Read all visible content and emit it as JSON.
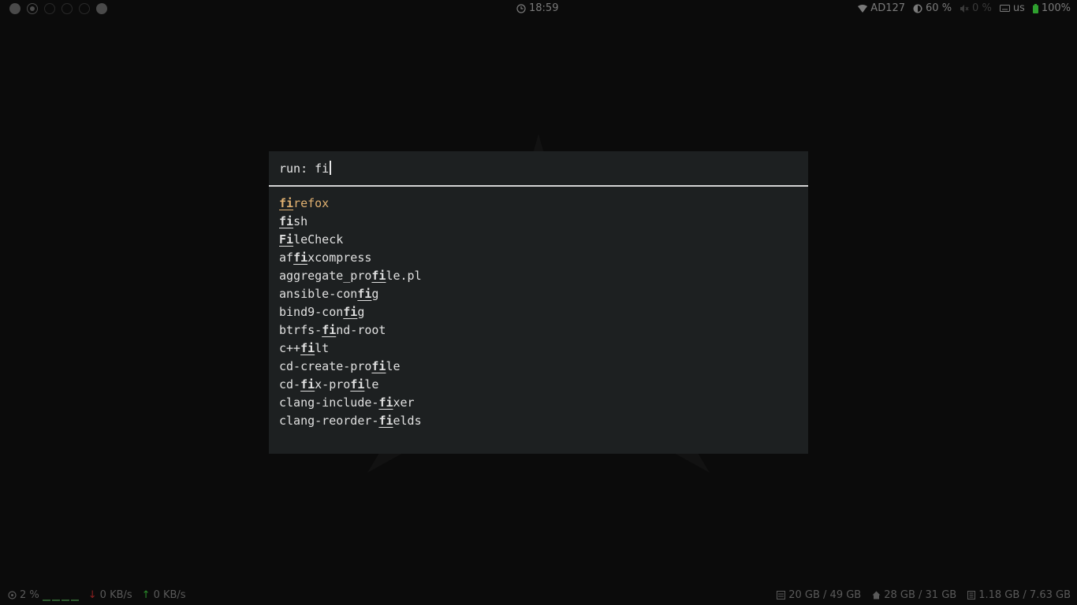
{
  "topbar": {
    "workspaces": [
      "filled",
      "ring",
      "outline",
      "outline-dark",
      "outline-dark",
      "filled"
    ],
    "clock": {
      "icon": "clock-icon",
      "time": "18:59"
    },
    "wifi": {
      "icon": "wifi-icon",
      "ssid": "AD127"
    },
    "brightness": {
      "icon": "brightness-icon",
      "value": "60 %"
    },
    "volume": {
      "icon": "volume-muted-icon",
      "value": "0 %"
    },
    "keyboard": {
      "icon": "keyboard-icon",
      "layout": "us"
    },
    "battery": {
      "icon": "battery-icon",
      "value": "100%"
    }
  },
  "launcher": {
    "prompt": "run:",
    "input": "fi",
    "results": [
      {
        "pre": "",
        "match": "fi",
        "post": "refox",
        "selected": true
      },
      {
        "pre": "",
        "match": "fi",
        "post": "sh"
      },
      {
        "pre": "",
        "match": "Fi",
        "post": "leCheck"
      },
      {
        "pre": "af",
        "match": "fi",
        "post": "xcompress"
      },
      {
        "pre": "aggregate_pro",
        "match": "fi",
        "post": "le.pl"
      },
      {
        "pre": "ansible-con",
        "match": "fi",
        "post": "g"
      },
      {
        "pre": "bind9-con",
        "match": "fi",
        "post": "g"
      },
      {
        "pre": "btrfs-",
        "match": "fi",
        "post": "nd-root"
      },
      {
        "pre": "c++",
        "match": "fi",
        "post": "lt"
      },
      {
        "pre": "cd-create-pro",
        "match": "fi",
        "post": "le"
      },
      {
        "pre": "cd-",
        "match": "fi",
        "post": "x-pro",
        "match2": "fi",
        "post2": "le"
      },
      {
        "pre": "clang-include-",
        "match": "fi",
        "post": "xer"
      },
      {
        "pre": "clang-reorder-",
        "match": "fi",
        "post": "elds"
      }
    ]
  },
  "bottombar": {
    "cpu": {
      "icon": "cpu-icon",
      "value": "2 %"
    },
    "net_down": {
      "icon": "arrow-down-icon",
      "value": "0 KB/s"
    },
    "net_up": {
      "icon": "arrow-up-icon",
      "value": "0 KB/s"
    },
    "disk_root": {
      "icon": "disk-icon",
      "value": "20 GB / 49 GB"
    },
    "disk_home": {
      "icon": "home-icon",
      "value": "28 GB / 31 GB"
    },
    "memory": {
      "icon": "memory-icon",
      "value": "1.18 GB / 7.63 GB"
    }
  },
  "colors": {
    "selected": "#e0b070",
    "launcher_bg": "#1d2021",
    "background": "#0b0b0b"
  }
}
